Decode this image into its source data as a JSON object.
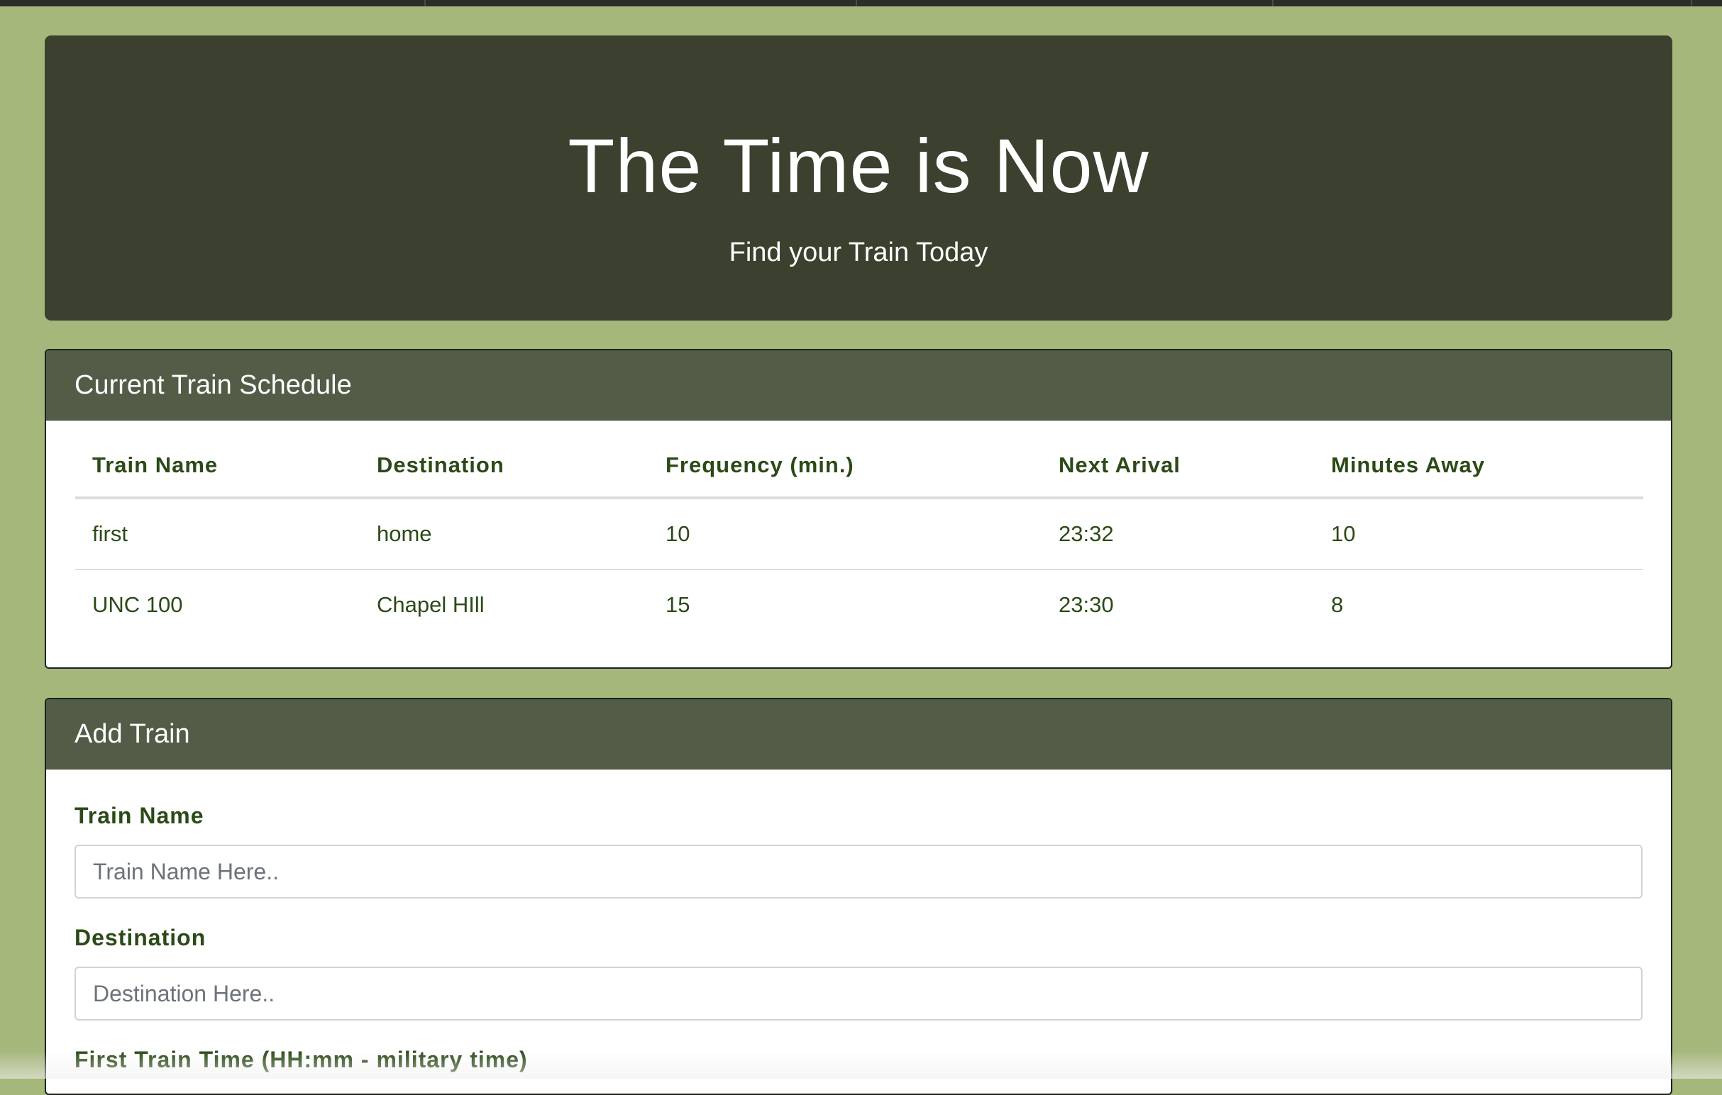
{
  "header": {
    "title": "The Time is Now",
    "subtitle": "Find your Train Today"
  },
  "schedule": {
    "heading": "Current Train Schedule",
    "columns": [
      "Train Name",
      "Destination",
      "Frequency (min.)",
      "Next Arival",
      "Minutes Away"
    ],
    "rows": [
      [
        "first",
        "home",
        "10",
        "23:32",
        "10"
      ],
      [
        "UNC 100",
        "Chapel HIll",
        "15",
        "23:30",
        "8"
      ]
    ]
  },
  "add_train": {
    "heading": "Add Train",
    "name_label": "Train Name",
    "name_placeholder": "Train Name Here..",
    "destination_label": "Destination",
    "destination_placeholder": "Destination Here..",
    "first_time_label": "First Train Time (HH:mm - military time)"
  },
  "colors": {
    "page_background": "#a5b77b",
    "jumbotron": "#3c412f",
    "card_header": "#535c47",
    "text_green": "#2b4a17"
  }
}
